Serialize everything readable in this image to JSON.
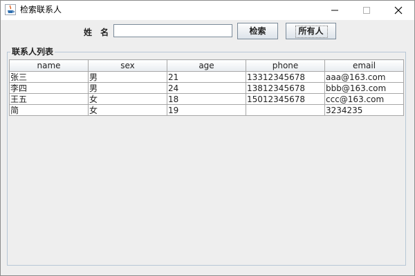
{
  "window": {
    "title": "检索联系人",
    "icon": "java-cup-icon"
  },
  "search": {
    "label": "姓 名",
    "value": "",
    "placeholder": ""
  },
  "buttons": {
    "search_label": "检索",
    "all_label": "所有人"
  },
  "group": {
    "title": "联系人列表"
  },
  "table": {
    "columns": [
      "name",
      "sex",
      "age",
      "phone",
      "email"
    ],
    "rows": [
      [
        "张三",
        "男",
        "21",
        "13312345678",
        "aaa@163.com"
      ],
      [
        "李四",
        "男",
        "24",
        "13812345678",
        "bbb@163.com"
      ],
      [
        "王五",
        "女",
        "18",
        "15012345678",
        "ccc@163.com"
      ],
      [
        "简",
        "女",
        "19",
        "",
        "3234235"
      ]
    ]
  },
  "colors": {
    "panel_bg": "#eeeeee",
    "title_bar_bg": "#ffffff",
    "group_border": "#b7c7d6",
    "grid_line": "#a6a6a6"
  }
}
